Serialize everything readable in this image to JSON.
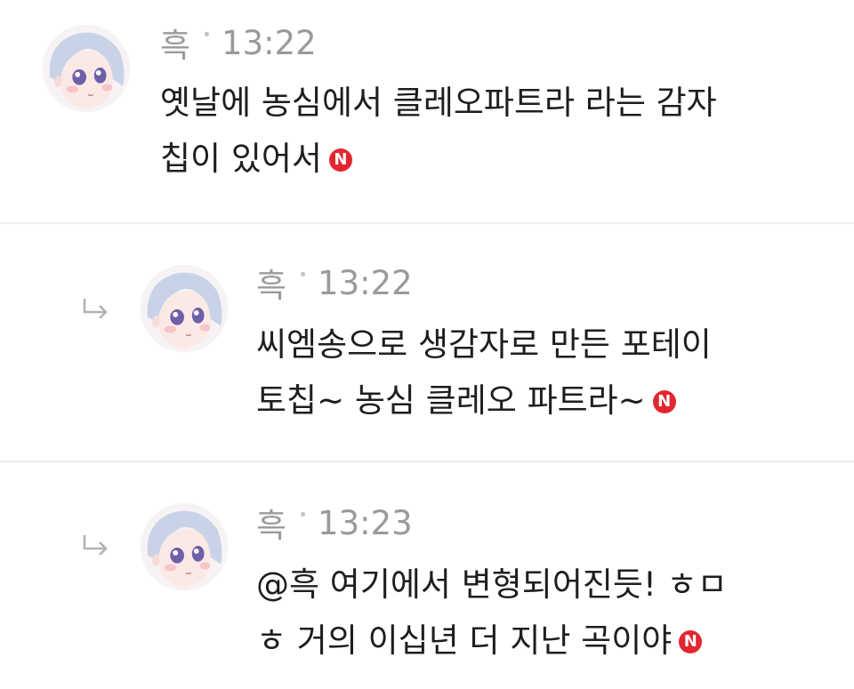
{
  "comments": [
    {
      "author": "흑",
      "time": "13:22",
      "lines": [
        "옛날에 농심에서 클레오파트라 라는 감자",
        "칩이 있어서"
      ],
      "badge": "N",
      "is_reply": false
    },
    {
      "author": "흑",
      "time": "13:22",
      "lines": [
        "씨엠송으로 생감자로 만든 포테이",
        "토칩~ 농심 클레오 파트라~"
      ],
      "badge": "N",
      "is_reply": true
    },
    {
      "author": "흑",
      "time": "13:23",
      "lines": [
        "@흑  여기에서 변형되어진듯! ㅎㅁ",
        "ㅎ 거의 이십년 더 지난 곡이야"
      ],
      "badge": "N",
      "is_reply": true
    }
  ],
  "icons": {
    "avatar": "avatar-illustration",
    "reply": "reply-arrow-icon",
    "new_badge": "new-badge-icon"
  },
  "colors": {
    "badge": "#e2262f",
    "meta_text": "#9a9a9a",
    "divider": "#ededed"
  }
}
